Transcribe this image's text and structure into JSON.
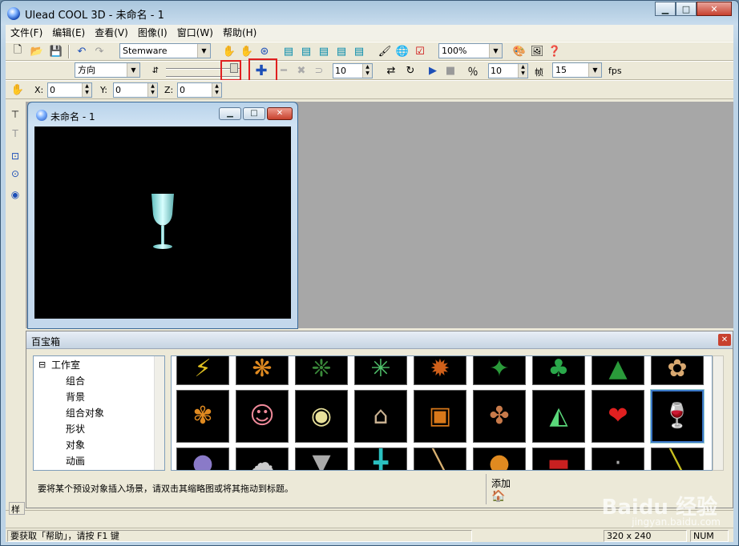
{
  "window": {
    "title": "Ulead COOL 3D - 未命名 - 1",
    "minimize": "▁",
    "maximize": "□",
    "close": "✕"
  },
  "menubar": [
    "文件(F)",
    "编辑(E)",
    "查看(V)",
    "图像(I)",
    "窗口(W)",
    "帮助(H)"
  ],
  "toolbar1": {
    "font": "Stemware",
    "zoom": "100%"
  },
  "toolbar2": {
    "mode": "方向",
    "frame_spin": "10",
    "fps_spin": "10",
    "frame_label": "帧",
    "frames_value": "15",
    "fps_label": "fps"
  },
  "toolbar3": {
    "x_label": "X:",
    "x_value": "0",
    "y_label": "Y:",
    "y_value": "0",
    "z_label": "Z:",
    "z_value": "0"
  },
  "child_window": {
    "title": "未命名 - 1"
  },
  "panel": {
    "title": "百宝箱",
    "tree": [
      "工作室",
      "组合",
      "背景",
      "组合对象",
      "形状",
      "对象",
      "动画"
    ],
    "hint": "要将某个预设对象插入场景，请双击其缩略图或将其拖动到标题。",
    "add_label": "添加"
  },
  "statusbar": {
    "help": "要获取「帮助」，请按 F1 键",
    "size": "320 x 240",
    "num": "NUM"
  },
  "watermark": {
    "logo": "Baidu 经验",
    "url": "jingyan.baidu.com"
  },
  "colors": {
    "highlight": "#e02020",
    "selection": "#3a77c8",
    "canvas": "#000000"
  }
}
